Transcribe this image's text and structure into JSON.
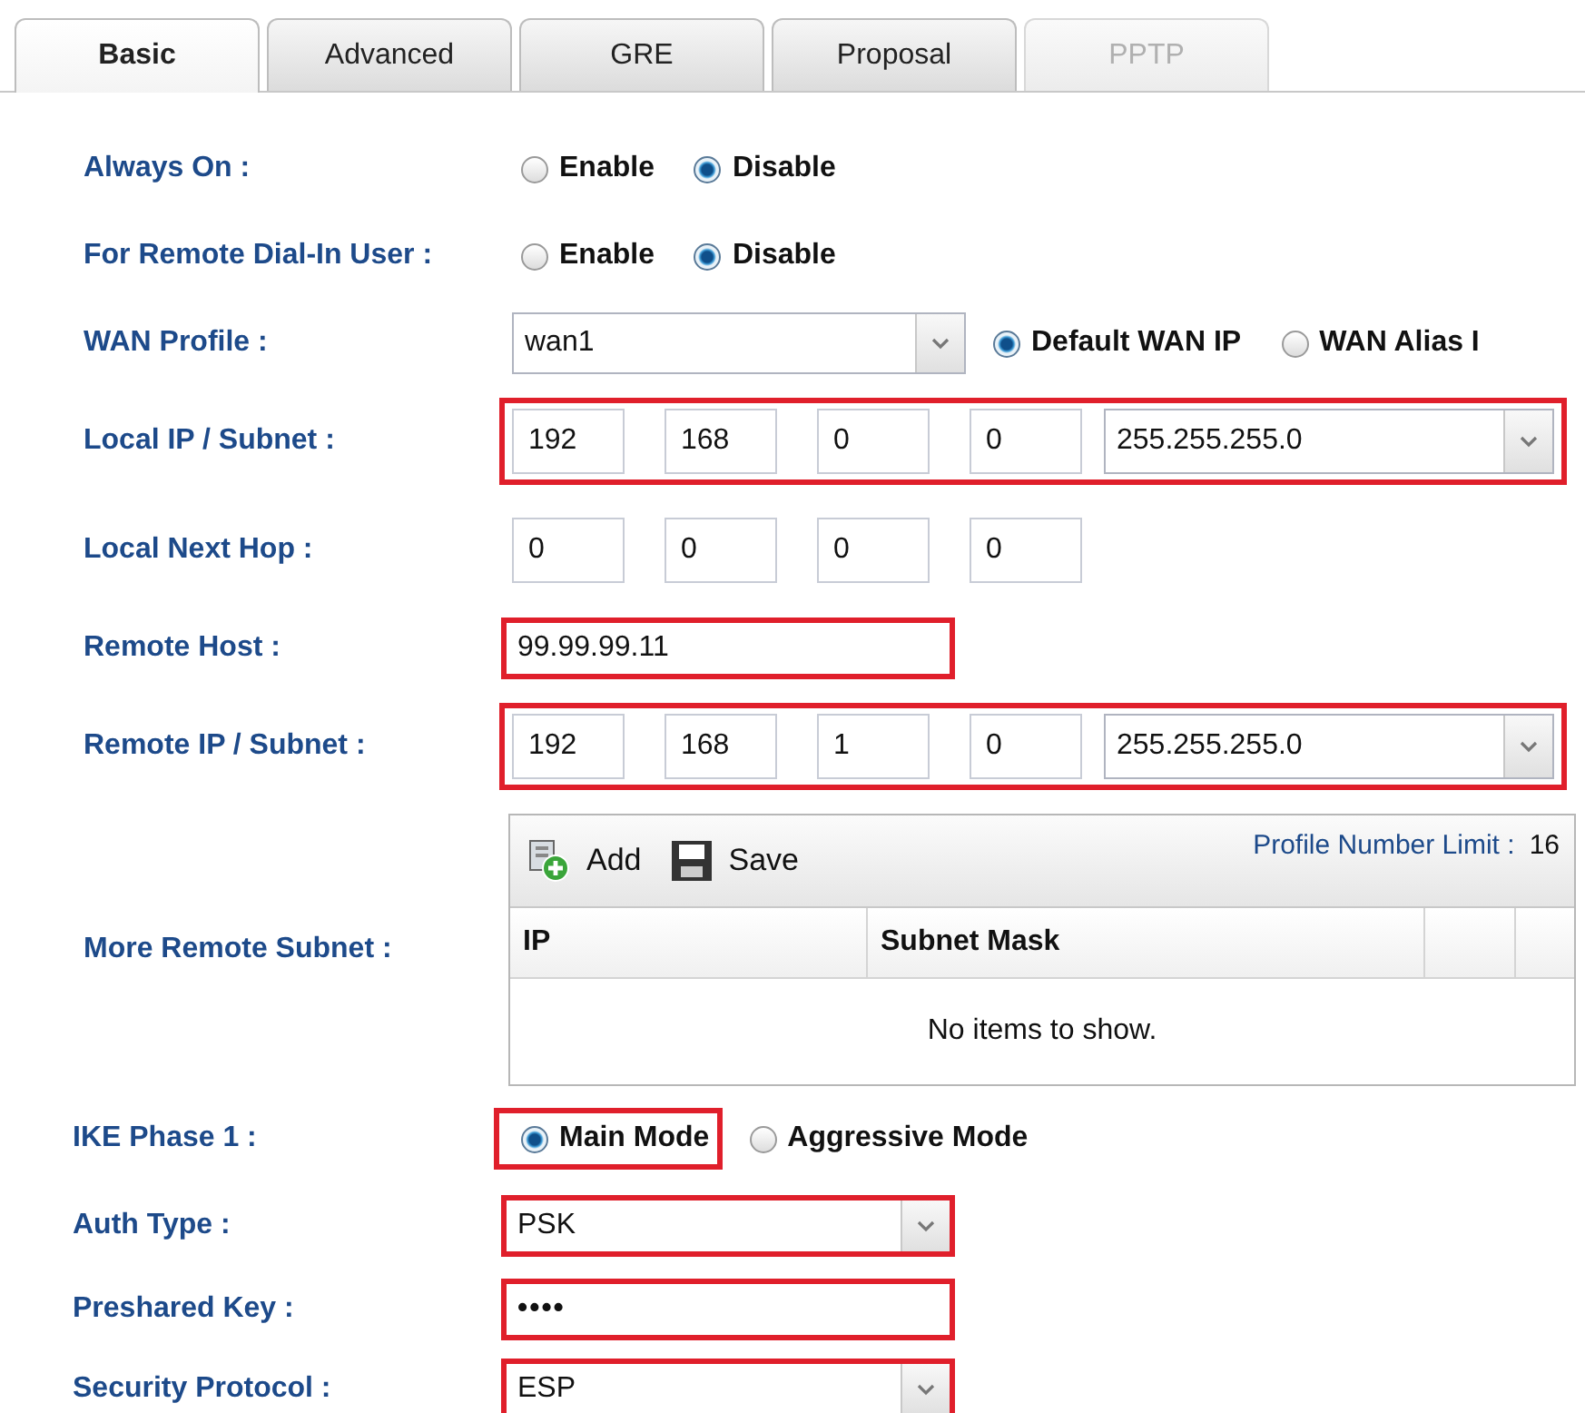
{
  "tabs": [
    {
      "label": "Basic",
      "selected": true,
      "disabled": false
    },
    {
      "label": "Advanced",
      "selected": false,
      "disabled": false
    },
    {
      "label": "GRE",
      "selected": false,
      "disabled": false
    },
    {
      "label": "Proposal",
      "selected": false,
      "disabled": false
    },
    {
      "label": "PPTP",
      "selected": false,
      "disabled": true
    }
  ],
  "rows": [
    {
      "kind": "radio",
      "label": "Always On :",
      "options": [
        {
          "label": "Enable",
          "selected": false
        },
        {
          "label": "Disable",
          "selected": true
        }
      ]
    },
    {
      "kind": "radio",
      "label": "For Remote Dial-In User :",
      "options": [
        {
          "label": "Enable",
          "selected": false
        },
        {
          "label": "Disable",
          "selected": true
        }
      ]
    },
    {
      "kind": "select_radio",
      "label": "WAN Profile :",
      "value": "wan1",
      "options": [
        {
          "label": "Default WAN IP",
          "selected": true
        },
        {
          "label": "WAN Alias I",
          "selected": false
        }
      ]
    },
    {
      "kind": "ip_subnet",
      "label": "Local IP / Subnet :",
      "highlighted": true,
      "octets": [
        "192",
        "168",
        "0",
        "0"
      ],
      "subnet": "255.255.255.0"
    },
    {
      "kind": "ip",
      "label": "Local Next Hop :",
      "octets": [
        "0",
        "0",
        "0",
        "0"
      ]
    },
    {
      "kind": "text",
      "label": "Remote Host :",
      "highlighted": true,
      "value": "99.99.99.11"
    },
    {
      "kind": "ip_subnet",
      "label": "Remote IP / Subnet :",
      "highlighted": true,
      "octets": [
        "192",
        "168",
        "1",
        "0"
      ],
      "subnet": "255.255.255.0"
    },
    {
      "kind": "grid",
      "label": "More Remote Subnet :",
      "add": "Add",
      "save": "Save",
      "limit_label": "Profile Number Limit :",
      "limit": "16",
      "columns": [
        "IP",
        "Subnet Mask"
      ],
      "empty": "No items to show."
    },
    {
      "kind": "radio",
      "label": "IKE Phase 1 :",
      "highlighted": true,
      "options": [
        {
          "label": "Main Mode",
          "selected": true
        },
        {
          "label": "Aggressive Mode",
          "selected": false
        }
      ]
    },
    {
      "kind": "select",
      "label": "Auth Type :",
      "highlighted": true,
      "value": "PSK"
    },
    {
      "kind": "password",
      "label": "Preshared Key :",
      "highlighted": true,
      "value": "••••"
    },
    {
      "kind": "select",
      "label": "Security Protocol :",
      "highlighted": true,
      "value": "ESP"
    }
  ]
}
